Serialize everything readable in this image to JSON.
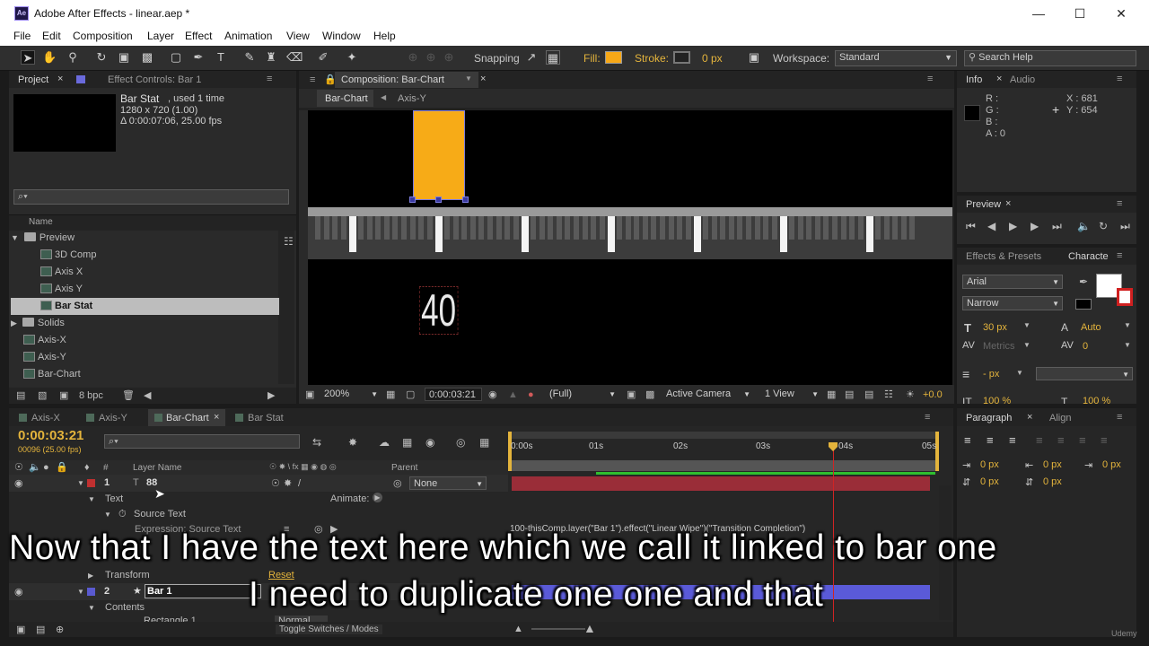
{
  "window": {
    "title": "Adobe After Effects - linear.aep *",
    "logo": "Ae"
  },
  "menu": [
    "File",
    "Edit",
    "Composition",
    "Layer",
    "Effect",
    "Animation",
    "View",
    "Window",
    "Help"
  ],
  "toolbar": {
    "snapping_label": "Snapping",
    "fill_label": "Fill:",
    "stroke_label": "Stroke:",
    "stroke_width": "0 px",
    "workspace_label": "Workspace:",
    "workspace_value": "Standard",
    "search_help": "Search Help",
    "fill_color": "#f7a817"
  },
  "project": {
    "tab_project": "Project",
    "tab_effect_controls": "Effect Controls: Bar 1",
    "selected_name": "Bar Stat",
    "used_text": ", used 1 time",
    "dimensions": "1280 x 720 (1.00)",
    "duration": "Δ 0:00:07:06, 25.00 fps",
    "search_placeholder": "⌕▾",
    "column_name": "Name",
    "items": [
      {
        "label": "Preview",
        "type": "folder",
        "expanded": true
      },
      {
        "label": "3D Comp",
        "type": "comp"
      },
      {
        "label": "Axis X",
        "type": "comp"
      },
      {
        "label": "Axis Y",
        "type": "comp"
      },
      {
        "label": "Bar Stat",
        "type": "comp",
        "selected": true
      },
      {
        "label": "Solids",
        "type": "folder"
      },
      {
        "label": "Axis-X",
        "type": "comp"
      },
      {
        "label": "Axis-Y",
        "type": "comp"
      },
      {
        "label": "Bar-Chart",
        "type": "comp"
      }
    ],
    "bpc": "8 bpc"
  },
  "composition": {
    "tab": "Composition: Bar-Chart",
    "breadcrumb": [
      "Bar-Chart",
      "Axis-Y"
    ],
    "bar_color": "#f7ab17",
    "number_text": "40",
    "zoom": "200%",
    "timecode": "0:00:03:21",
    "resolution": "(Full)",
    "camera": "Active Camera",
    "view": "1 View",
    "exposure": "+0.0"
  },
  "info": {
    "tab_info": "Info",
    "tab_audio": "Audio",
    "r": "R :",
    "g": "G :",
    "b": "B :",
    "a": "A : 0",
    "x": "X : 681",
    "y": "Y : 654"
  },
  "preview": {
    "tab": "Preview"
  },
  "effects": {
    "tab_effects": "Effects & Presets",
    "tab_character": "Characte"
  },
  "character": {
    "font": "Arial",
    "style": "Narrow",
    "size": "30 px",
    "leading": "Auto",
    "kerning": "Metrics",
    "tracking": "0",
    "stroke_width": "- px",
    "scale_v": "100 %",
    "scale_h": "100 %"
  },
  "paragraph": {
    "tab_paragraph": "Paragraph",
    "tab_align": "Align",
    "indent_values": [
      "0 px",
      "0 px",
      "0 px",
      "0 px",
      "0 px"
    ]
  },
  "timeline": {
    "tabs": [
      "Axis-X",
      "Axis-Y",
      "Bar-Chart",
      "Bar Stat"
    ],
    "active_tab": "Bar-Chart",
    "timecode": "0:00:03:21",
    "fps": "00096 (25.00 fps)",
    "col_layer_name": "Layer Name",
    "col_number": "#",
    "col_parent": "Parent",
    "ruler_labels": [
      "0:00s",
      "01s",
      "02s",
      "03s",
      "04s",
      "05s"
    ],
    "layer1": {
      "num": "1",
      "name": "88",
      "parent": "None"
    },
    "text_label": "Text",
    "animate_label": "Animate:",
    "source_text": "Source Text",
    "expression_label": "Expression: Source Text",
    "expression": "100-thisComp.layer(\"Bar 1\").effect(\"Linear Wipe\")(\"Transition Completion\")",
    "transform_label": "Transform",
    "reset_label": "Reset",
    "layer2": {
      "num": "2",
      "name": "Bar 1"
    },
    "contents_label": "Contents",
    "rectangle_label": "Rectangle 1",
    "normal_label": "Normal",
    "toggle_label": "Toggle Switches / Modes"
  },
  "subtitles": {
    "line1": "Now that I have the text here which we call it linked to bar one",
    "line2": "I need to duplicate one one and that"
  },
  "watermark": "Udemy"
}
